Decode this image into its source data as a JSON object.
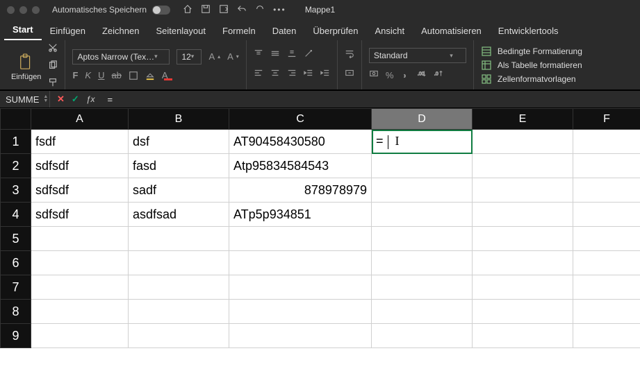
{
  "titlebar": {
    "autosave_label": "Automatisches Speichern",
    "doc_title": "Mappe1",
    "qat_icons": [
      "home-icon",
      "save-icon",
      "export-icon",
      "undo-icon",
      "redo-icon",
      "more-icon"
    ]
  },
  "tabs": [
    "Start",
    "Einfügen",
    "Zeichnen",
    "Seitenlayout",
    "Formeln",
    "Daten",
    "Überprüfen",
    "Ansicht",
    "Automatisieren",
    "Entwicklertools"
  ],
  "active_tab": 0,
  "ribbon": {
    "paste_label": "Einfügen",
    "font_name": "Aptos Narrow (Tex…",
    "font_size": "12",
    "bold": "F",
    "italic": "K",
    "underline": "U",
    "number_format": "Standard",
    "style_cmds": [
      {
        "icon": "cond-format-icon",
        "label": "Bedingte Formatierung"
      },
      {
        "icon": "format-table-icon",
        "label": "Als Tabelle formatieren"
      },
      {
        "icon": "cell-styles-icon",
        "label": "Zellenformatvorlagen"
      }
    ]
  },
  "formula_bar": {
    "name_box": "SUMME",
    "formula": "="
  },
  "sheet": {
    "columns": [
      "A",
      "B",
      "C",
      "D",
      "E",
      "F"
    ],
    "active_col": "D",
    "active_cell": "D1",
    "editing_value": "=",
    "rows": [
      {
        "n": 1,
        "A": "fsdf",
        "B": "dsf",
        "C": "AT90458430580",
        "D": "=",
        "E": "",
        "F": ""
      },
      {
        "n": 2,
        "A": "sdfsdf",
        "B": "fasd",
        "C": "Atp95834584543",
        "D": "",
        "E": "",
        "F": ""
      },
      {
        "n": 3,
        "A": "sdfsdf",
        "B": "sadf",
        "C": "878978979",
        "C_num": true,
        "D": "",
        "E": "",
        "F": ""
      },
      {
        "n": 4,
        "A": "sdfsdf",
        "B": "asdfsad",
        "C": "ATp5p934851",
        "D": "",
        "E": "",
        "F": ""
      },
      {
        "n": 5
      },
      {
        "n": 6
      },
      {
        "n": 7
      },
      {
        "n": 8
      },
      {
        "n": 9
      }
    ]
  }
}
